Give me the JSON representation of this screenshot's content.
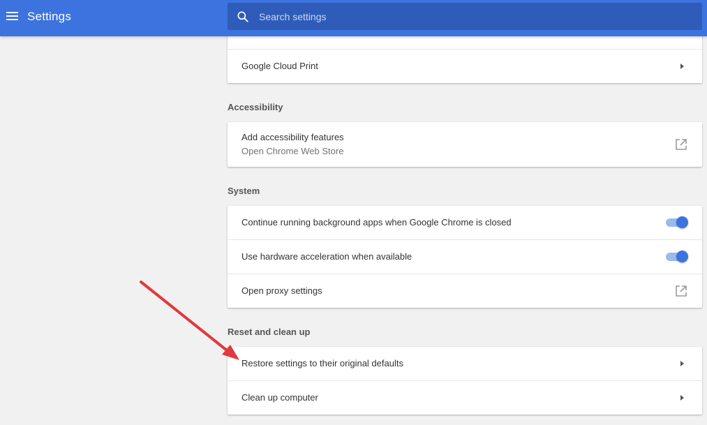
{
  "header": {
    "menu_icon": "hamburger-menu-icon",
    "title": "Settings",
    "search": {
      "placeholder": "Search settings",
      "icon": "search-icon"
    }
  },
  "printing": {
    "items": [
      {
        "label": "Google Cloud Print",
        "icon": "chevron-right-icon"
      }
    ]
  },
  "accessibility": {
    "title": "Accessibility",
    "items": [
      {
        "label": "Add accessibility features",
        "sublabel": "Open Chrome Web Store",
        "icon": "open-in-new-icon"
      }
    ]
  },
  "system": {
    "title": "System",
    "items": [
      {
        "label": "Continue running background apps when Google Chrome is closed",
        "toggle": true
      },
      {
        "label": "Use hardware acceleration when available",
        "toggle": true
      },
      {
        "label": "Open proxy settings",
        "icon": "open-in-new-icon"
      }
    ]
  },
  "reset": {
    "title": "Reset and clean up",
    "items": [
      {
        "label": "Restore settings to their original defaults",
        "icon": "chevron-right-icon"
      },
      {
        "label": "Clean up computer",
        "icon": "chevron-right-icon"
      }
    ]
  },
  "colors": {
    "header": "#3d73de",
    "search": "#2f5cb8",
    "toggle_on": "#3d73de",
    "annotation_arrow": "#e0393e"
  }
}
